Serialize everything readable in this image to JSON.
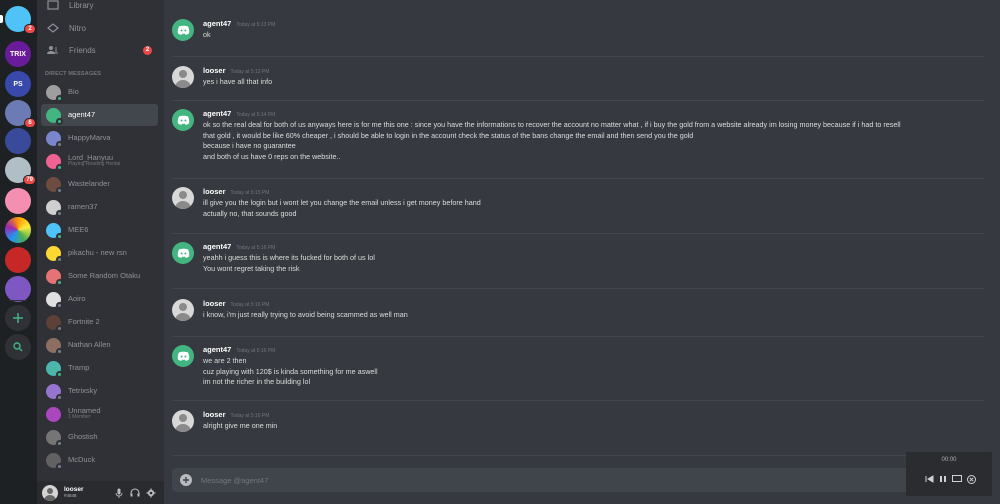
{
  "servers": [
    {
      "name": "server-1",
      "badge": "2",
      "color": "#4fc3f7"
    },
    {
      "name": "server-trix",
      "label": "TRIX",
      "badge": "",
      "color": "#7b1fa2"
    },
    {
      "name": "server-ps",
      "label": "PS",
      "badge": "",
      "color": "#5c6bc0"
    },
    {
      "name": "server-4",
      "badge": "6",
      "color": "#6d7bb4"
    },
    {
      "name": "server-5",
      "badge": "",
      "color": "#3a4a9a"
    },
    {
      "name": "server-6",
      "badge": "79",
      "color": "#b0bec5"
    },
    {
      "name": "server-7",
      "badge": "",
      "color": "#f48fb1"
    },
    {
      "name": "server-8",
      "badge": "",
      "color": "#ff9800"
    },
    {
      "name": "server-9",
      "badge": "",
      "color": "#ef5350"
    },
    {
      "name": "server-10",
      "badge": "",
      "color": "#9575cd"
    }
  ],
  "nav": {
    "library": "Library",
    "nitro": "Nitro",
    "friends": "Friends",
    "friends_badge": "2"
  },
  "dm_header": "DIRECT MESSAGES",
  "dms": [
    {
      "name": "Bio",
      "sub": "",
      "color": "#9e9e9e",
      "status": "#43b581"
    },
    {
      "name": "agent47",
      "sub": "",
      "color": "#43b581",
      "status": "#43b581"
    },
    {
      "name": "HappyMarva",
      "sub": "",
      "color": "#7986cb",
      "status": "#747f8d"
    },
    {
      "name": "Lord_Hanyuu",
      "sub": "Playing Reading Hentai",
      "color": "#f06292",
      "status": "#43b581"
    },
    {
      "name": "Wastelander",
      "sub": "",
      "color": "#6d4c41",
      "status": "#747f8d"
    },
    {
      "name": "ramen37",
      "sub": "",
      "color": "#cfcfcf",
      "status": "#747f8d"
    },
    {
      "name": "MEE6",
      "sub": "",
      "color": "#4fc3f7",
      "status": "#43b581"
    },
    {
      "name": "pikachu - new rsn",
      "sub": "",
      "color": "#fdd835",
      "status": "#747f8d"
    },
    {
      "name": "Some Random Otaku",
      "sub": "",
      "color": "#e57373",
      "status": "#43b581"
    },
    {
      "name": "Aoiro",
      "sub": "",
      "color": "#e0e0e0",
      "status": "#747f8d"
    },
    {
      "name": "Fortnite 2",
      "sub": "",
      "color": "#5d4037",
      "status": "#747f8d"
    },
    {
      "name": "Nathan Allen",
      "sub": "",
      "color": "#8d6e63",
      "status": "#747f8d"
    },
    {
      "name": "Tramp",
      "sub": "",
      "color": "#4db6ac",
      "status": "#43b581"
    },
    {
      "name": "Tetrixsky",
      "sub": "",
      "color": "#9575cd",
      "status": "#747f8d"
    },
    {
      "name": "Unnamed",
      "sub": "1 Member",
      "color": "#ab47bc",
      "status": ""
    },
    {
      "name": "Ghostish",
      "sub": "",
      "color": "#757575",
      "status": "#747f8d"
    },
    {
      "name": "McDuck",
      "sub": "",
      "color": "#616161",
      "status": "#747f8d"
    }
  ],
  "user": {
    "name": "looser",
    "tag": "#4848"
  },
  "messages": [
    {
      "author": "agent47",
      "time": "Today at 5:13 PM",
      "avatar": "bot",
      "lines": [
        "ok"
      ]
    },
    {
      "author": "looser",
      "time": "Today at 5:13 PM",
      "avatar": "looser",
      "lines": [
        "yes i have all that info"
      ]
    },
    {
      "author": "agent47",
      "time": "Today at 5:14 PM",
      "avatar": "bot",
      "lines": [
        "ok so the real deal for both of us anyways here is for me this one : since you have the informations to recover the account no matter what , if i buy the gold from a website already im losing money because if i had to resell",
        "that gold , it would be like 60% cheaper , i should be able to login in the account check the status of the bans change the email and then send you the gold",
        "because i have no guarantee",
        "and both of us have 0 reps on the website.."
      ]
    },
    {
      "author": "looser",
      "time": "Today at 5:15 PM",
      "avatar": "looser",
      "lines": [
        "ill give you the login but i wont let you change the email unless i get money before hand",
        "actually no, that sounds good"
      ]
    },
    {
      "author": "agent47",
      "time": "Today at 5:16 PM",
      "avatar": "bot",
      "lines": [
        "yeahh i guess this is where its fucked for both of us lol",
        "You wont regret taking the risk"
      ]
    },
    {
      "author": "looser",
      "time": "Today at 5:16 PM",
      "avatar": "looser",
      "lines": [
        "i know, i'm just really trying to avoid being scammed as well man"
      ]
    },
    {
      "author": "agent47",
      "time": "Today at 5:16 PM",
      "avatar": "bot",
      "lines": [
        "we are 2 then",
        "cuz playing with 120$ is kinda something for me aswell",
        "im not the richer in the building lol"
      ]
    },
    {
      "author": "looser",
      "time": "Today at 5:16 PM",
      "avatar": "looser",
      "lines": [
        "alright give me one min"
      ]
    }
  ],
  "composer": {
    "placeholder": "Message @agent47"
  },
  "video": {
    "time": "00:00"
  }
}
